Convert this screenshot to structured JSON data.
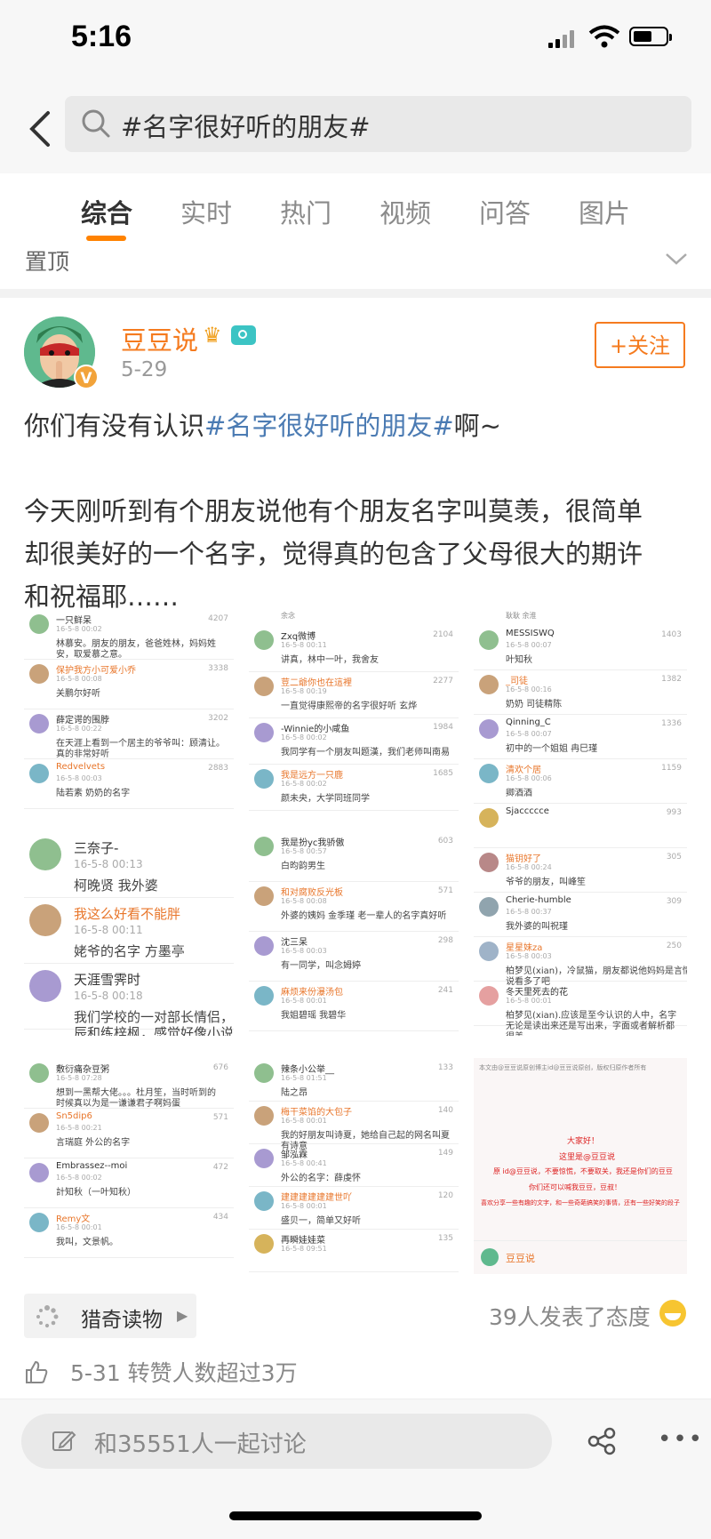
{
  "status_bar": {
    "time": "5:16"
  },
  "search": {
    "query": "#名字很好听的朋友#"
  },
  "tabs": [
    "综合",
    "实时",
    "热门",
    "视频",
    "问答",
    "图片"
  ],
  "pinned_label": "置顶",
  "post": {
    "author": "豆豆说",
    "date": "5-29",
    "follow_label": "+关注",
    "line1_pre": "你们有没有认识",
    "line1_tag": "#名字很好听的朋友#",
    "line1_post": "啊~",
    "body_lines": [
      "今天刚听到有个朋友说他有个朋友名字叫莫羡，很简单",
      "却很美好的一个名字，觉得真的包含了父母很大的期许",
      "和祝福耶……"
    ]
  },
  "screenshots": {
    "p1": [
      {
        "name": "一只鲜呆",
        "time": "16-5-8 00:02",
        "likes": "4207",
        "text": "林慕安。朋友的朋友，爸爸姓林，妈妈姓",
        "text2": "安，取爱慕之意。"
      },
      {
        "name": "保护我方小可爱小乔",
        "time": "16-5-8 00:08",
        "likes": "3338",
        "text": "关鹏尔好听"
      },
      {
        "name": "薛定谔的围脖",
        "time": "16-5-8 00:22",
        "likes": "3202",
        "text": "在天涯上看到一个居主的爷爷叫：顾清让。",
        "text2": "真的非常好听"
      },
      {
        "name": "Redvelvets",
        "time": "16-5-8 00:03",
        "likes": "2883",
        "text": "陆若素 奶奶的名字"
      }
    ],
    "p2": [
      {
        "name": "三奈子-",
        "time": "16-5-8 00:13",
        "text": "柯晚贤 我外婆"
      },
      {
        "name": "我这么好看不能胖",
        "time": "16-5-8 00:11",
        "text": "姥爷的名字 方墨亭"
      },
      {
        "name": "天涯雪霁时",
        "time": "16-5-8 00:18",
        "text": "我们学校的一对部长情侣，",
        "text2": "辰和练梓枫，感觉好像小说"
      }
    ],
    "p3": [
      {
        "name": "敷衍痛杂豆粥",
        "time": "16-5-8 07:28",
        "likes": "676",
        "text": "想到一黑帮大佬。。。杜月笙，当时听到的",
        "text2": "时候真以为是一谦谦君子啊妈蛋"
      },
      {
        "name": "Sn5dip6",
        "time": "16-5-8 00:21",
        "likes": "571",
        "text": "言瑞庭 外公的名字"
      },
      {
        "name": "Embrassez--moi",
        "time": "16-5-8 00:02",
        "likes": "472",
        "text": "計知秋（一叶知秋）"
      },
      {
        "name": "Remy文",
        "time": "16-5-8 00:01",
        "likes": "434",
        "text": "我叫，文景帆。"
      }
    ],
    "p4_top": "余念",
    "p4": [
      {
        "name": "Zxq微博",
        "time": "16-5-8 00:11",
        "likes": "2104",
        "text": "讲真，林中一叶，我舍友"
      },
      {
        "name": "荳二爺你也在這裡",
        "time": "16-5-8 00:19",
        "likes": "2277",
        "text": "一直觉得康熙帝的名字很好听  玄烨"
      },
      {
        "name": "-Winnie的小咸鱼",
        "time": "16-5-8 00:02",
        "likes": "1984",
        "text": "我同学有一个朋友叫题漢，我们老师叫南易"
      },
      {
        "name": "我是远方一只鹿",
        "time": "16-5-8 00:02",
        "likes": "1685",
        "text": "颜未央，大学同班同学"
      }
    ],
    "p5": [
      {
        "name": "我是扮yc我骄傲",
        "time": "16-5-8 00:57",
        "likes": "603",
        "text": "白昀韵男生"
      },
      {
        "name": "和对腐败反光板",
        "time": "16-5-8 00:08",
        "likes": "571",
        "text": "外婆的姨妈 金季瑾 老一辈人的名字真好听"
      },
      {
        "name": "沈三呆",
        "time": "16-5-8 00:03",
        "likes": "298",
        "text": "有一同学，叫念姆婷"
      },
      {
        "name": "麻烦来份瀑汤包",
        "time": "16-5-8 00:01",
        "likes": "241",
        "text": "我姐碧瑶 我碧华"
      }
    ],
    "p6": [
      {
        "name": "辣条小公举__",
        "time": "16-5-8 01:51",
        "likes": "133",
        "text": "陆之昂"
      },
      {
        "name": "梅干菜馅的大包子",
        "time": "16-5-8 00:01",
        "likes": "140",
        "text": "我的好朋友叫诗夏，她给自己起的网名叫夏",
        "text2": "有诗意"
      },
      {
        "name": "邹泓霖",
        "time": "16-5-8 00:41",
        "likes": "149",
        "text": "外公的名字：薛虔怀"
      },
      {
        "name": "建建建建建建世吖",
        "time": "16-5-8 00:01",
        "likes": "120",
        "text": "盛贝一，简单又好听"
      },
      {
        "name": "再瞬娃娃菜",
        "time": "16-5-8 09:51",
        "likes": "135",
        "text": ""
      }
    ],
    "p7_top": "耿耿 余淮",
    "p7": [
      {
        "name": "MESSISWQ",
        "time": "16-5-8 00:07",
        "likes": "1403",
        "text": "叶知秋"
      },
      {
        "name": "_司徒",
        "time": "16-5-8 00:16",
        "likes": "1382",
        "text": "奶奶  司徒精陈"
      },
      {
        "name": "Qinning_C",
        "time": "16-5-8 00:07",
        "likes": "1336",
        "text": "初中的一个姐姐 冉巳瑾"
      },
      {
        "name": "清欢个居",
        "time": "16-5-8 00:06",
        "likes": "1159",
        "text": "卿酒酒"
      },
      {
        "name": "Sjaccccce",
        "time": "",
        "likes": "993",
        "text": ""
      },
      {
        "name": "猫钥好了",
        "time": "16-5-8 00:24",
        "likes": "305",
        "text": "爷爷的朋友，叫峰笙"
      },
      {
        "name": "Cherie-humble",
        "time": "16-5-8 00:37",
        "likes": "309",
        "text": "我外婆的叫祝瑾"
      },
      {
        "name": "星星妹za",
        "time": "16-5-8 00:03",
        "likes": "250",
        "text": "柏梦见(xian)，冷鼠猫，朋友都说他妈妈是言情小",
        "text2": "说看多了吧"
      },
      {
        "name": "冬天里死去的花",
        "time": "16-5-8 00:01",
        "likes": "",
        "text": "柏梦见(xian).应该是至今认识的人中，名字",
        "text2": "无论是读出来还是写出来，字面或者解析都",
        "text3": "很美。"
      }
    ],
    "p8": {
      "top": "本文由@豆豆说原创博主id@豆豆说原创，版权归原作者所有",
      "l1": "大家好！",
      "l2": "这里是@豆豆说",
      "l3": "原 id@豆豆说，不要惊慌，不要取关，我还是你们的豆豆",
      "l4": "你们还可以喊我豆豆，豆叔！",
      "l5": "喜欢分享一些有趣的文字，和一些奇葩搞笑的事情，还有一些好笑的段子",
      "foot": "豆豆说"
    }
  },
  "source": {
    "label": "猎奇读物"
  },
  "attitude": "39人发表了态度",
  "likes_info": "5-31 转赞人数超过3万",
  "bottom": {
    "comment_placeholder": "和35551人一起讨论"
  },
  "colors": {
    "accent": "#ff8200",
    "username": "#f57b1f",
    "topic": "#4b7bb3"
  }
}
